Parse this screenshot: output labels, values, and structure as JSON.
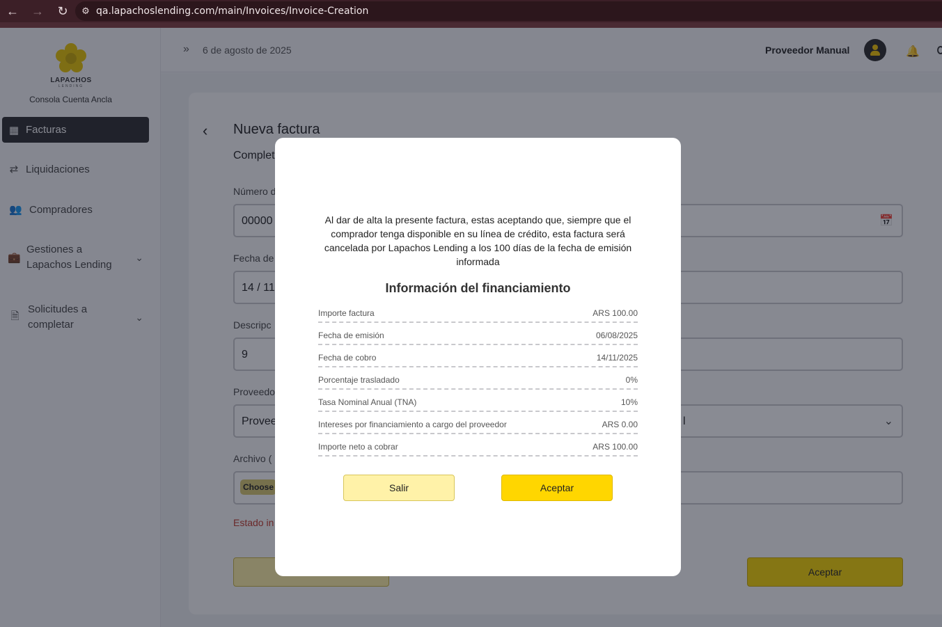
{
  "browser": {
    "url": "qa.lapachoslending.com/main/Invoices/Invoice-Creation"
  },
  "sidebar": {
    "logo_name": "LAPACHOS",
    "logo_sub": "LENDING",
    "console_label": "Consola Cuenta Ancla",
    "items": [
      {
        "label": "Facturas",
        "icon": "grid-icon",
        "active": true
      },
      {
        "label": "Liquidaciones",
        "icon": "swap-arrows-icon"
      },
      {
        "label": "Compradores",
        "icon": "users-icon"
      },
      {
        "label": "Gestiones a Lapachos Lending",
        "icon": "briefcase-icon",
        "expandable": true
      },
      {
        "label": "Solicitudes a completar",
        "icon": "file-user-icon",
        "expandable": true
      }
    ]
  },
  "header": {
    "date": "6 de agosto de 2025",
    "user_name": "Proveedor Manual"
  },
  "form": {
    "title": "Nueva factura",
    "subtitle": "Complet",
    "number_label": "Número d",
    "number_value": "00000",
    "date_label": "Fecha de",
    "date_value": "14 / 11",
    "desc_label": "Descripc",
    "desc_value": "9",
    "provider_label": "Proveedo",
    "provider_value": "Provee",
    "provider_value_tail": "l",
    "file_label": "Archivo (",
    "choose_label": "Choose",
    "status_text": "Estado in",
    "accept_label": "Aceptar"
  },
  "modal": {
    "message": "Al dar de alta la presente factura, estas aceptando que, siempre que el comprador tenga disponible en su línea de crédito, esta factura será cancelada por Lapachos Lending a los 100 días de la fecha de emisión informada",
    "heading": "Información del financiamiento",
    "rows": [
      {
        "label": "Importe factura",
        "value": "ARS 100.00"
      },
      {
        "label": "Fecha de emisión",
        "value": "06/08/2025"
      },
      {
        "label": "Fecha de cobro",
        "value": "14/11/2025"
      },
      {
        "label": "Porcentaje trasladado",
        "value": "0%"
      },
      {
        "label": "Tasa Nominal Anual (TNA)",
        "value": "10%"
      },
      {
        "label": "Intereses por financiamiento a cargo del proveedor",
        "value": "ARS 0.00"
      },
      {
        "label": "Importe neto a cobrar",
        "value": "ARS 100.00"
      }
    ],
    "cancel_label": "Salir",
    "accept_label": "Aceptar"
  },
  "colors": {
    "accent": "#ffd600",
    "accent_light": "#fff2a8",
    "sidebar_active": "#2d2d2f",
    "error": "#c0392b",
    "browser_bar": "#3c1f27"
  }
}
